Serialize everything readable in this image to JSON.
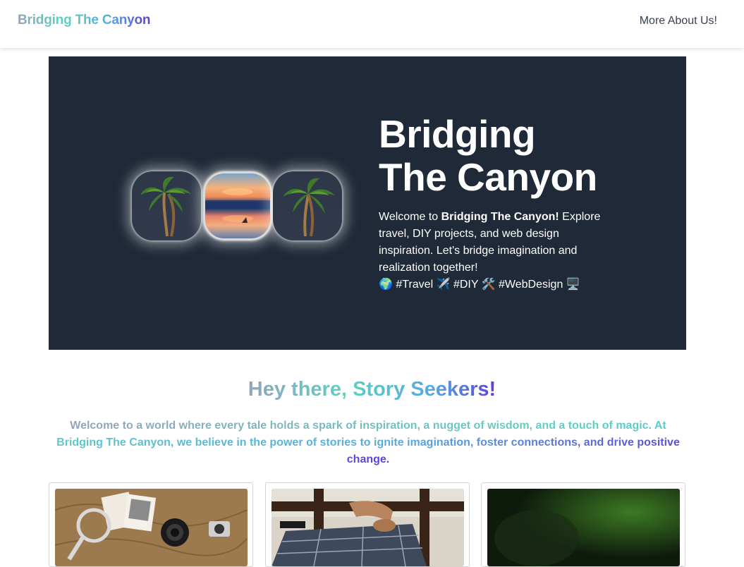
{
  "navbar": {
    "brand": "Bridging The Canyon",
    "link": "More About Us!"
  },
  "hero": {
    "title_line1": "Bridging",
    "title_line2": "The Canyon",
    "intro_prefix": "Welcome to ",
    "intro_brand": "Bridging The Canyon!",
    "intro_rest": " Explore travel, DIY projects, and web design inspiration. Let's bridge imagination and realization together!",
    "hashtags": "🌍 #Travel ✈️ #DIY 🛠️ #WebDesign 🖥️"
  },
  "section": {
    "heading": "Hey there, Story Seekers!",
    "text": "Welcome to a world where every tale holds a spark of inspiration, a nugget of wisdom, and a touch of magic. At Bridging The Canyon, we believe in the power of stories to ignite imagination, foster connections, and drive positive change."
  },
  "colors": {
    "hero_bg": "#1f2937",
    "gradient_start": "#94a3b8",
    "gradient_mid": "#5ed0c2",
    "gradient_end": "#5b3fd6"
  },
  "icons": {
    "window_left": "palm-tree-icon",
    "window_mid": "sunset-reflection-icon",
    "window_right": "palm-tree-icon"
  }
}
